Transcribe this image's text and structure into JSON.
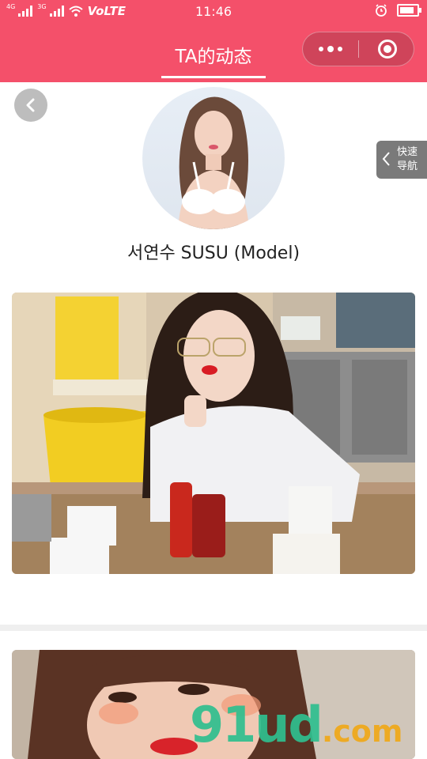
{
  "status_bar": {
    "sig1_label": "4G",
    "sig2_label": "3G",
    "network": "VoLTE",
    "time": "11:46"
  },
  "nav": {
    "title": "TA的动态",
    "accent_color": "#f4506a"
  },
  "quick_nav": {
    "label_line1": "快速",
    "label_line2": "导航"
  },
  "profile": {
    "name": "서연수 SUSU (Model)"
  },
  "posts": [
    {
      "image": "photo-woman-glasses-cafe"
    },
    {
      "image": "photo-woman-closeup"
    }
  ],
  "watermark": {
    "main": "91ud",
    "tld": ".com"
  },
  "icons": {
    "back": "back-arrow-icon",
    "more": "more-dots-icon",
    "close": "close-circle-icon",
    "alarm": "alarm-icon",
    "wifi": "wifi-icon",
    "battery": "battery-icon"
  }
}
